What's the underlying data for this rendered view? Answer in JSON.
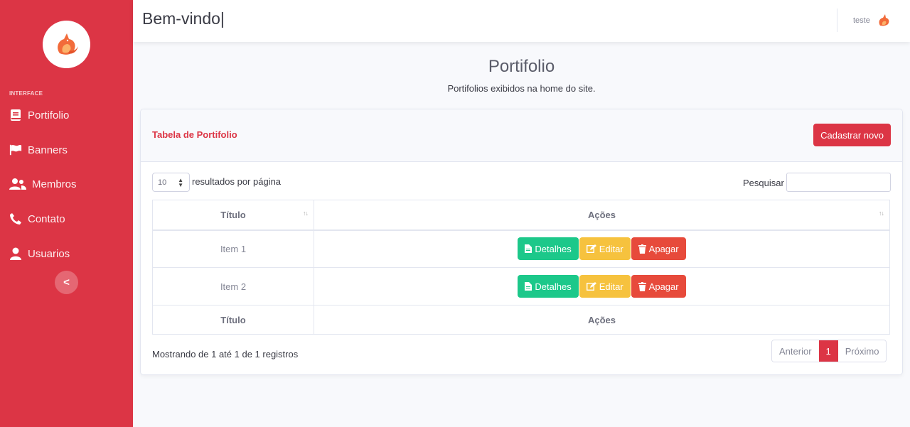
{
  "topbar": {
    "title": "Bem-vindo|",
    "user_name": "teste"
  },
  "sidebar": {
    "heading": "INTERFACE",
    "items": [
      {
        "label": "Portifolio",
        "icon": "book-icon"
      },
      {
        "label": "Banners",
        "icon": "flag-icon"
      },
      {
        "label": "Membros",
        "icon": "users-icon"
      },
      {
        "label": "Contato",
        "icon": "phone-icon"
      },
      {
        "label": "Usuarios",
        "icon": "user-icon"
      }
    ],
    "toggle_label": "<"
  },
  "page": {
    "title": "Portifolio",
    "subtitle": "Portifolios exibidos na home do site."
  },
  "card": {
    "title": "Tabela de Portifolio",
    "new_button": "Cadastrar novo",
    "length_value": "10",
    "length_label": "resultados por página",
    "search_label": "Pesquisar",
    "search_value": ""
  },
  "table": {
    "headers": [
      "Título",
      "Ações"
    ],
    "rows": [
      {
        "titulo": "Item 1"
      },
      {
        "titulo": "Item 2"
      }
    ],
    "actions": {
      "details": "Detalhes",
      "edit": "Editar",
      "delete": "Apagar"
    },
    "footer": [
      "Título",
      "Ações"
    ]
  },
  "info": "Mostrando de 1 até 1 de 1 registros",
  "pagination": {
    "prev": "Anterior",
    "current": "1",
    "next": "Próximo"
  },
  "colors": {
    "primary": "#dc3545",
    "success": "#1cc88a",
    "warning": "#f6c23e",
    "danger": "#e74a3b"
  }
}
